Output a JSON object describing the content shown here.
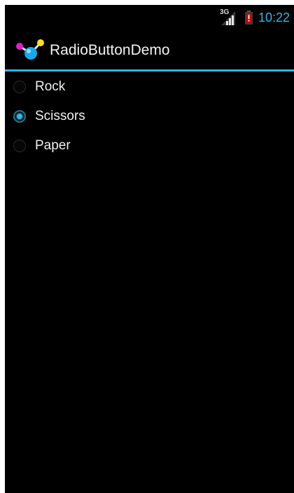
{
  "status_bar": {
    "network_type": "3G",
    "time": "10:22",
    "icons": [
      "signal-icon",
      "battery-alert-icon"
    ],
    "colors": {
      "clock": "#33b5e5",
      "battery_alert": "#cc0000"
    }
  },
  "action_bar": {
    "title": "RadioButtonDemo",
    "icon": "app-icon",
    "divider_color": "#33b5e5"
  },
  "radio_group": {
    "options": [
      {
        "label": "Rock",
        "checked": false
      },
      {
        "label": "Scissors",
        "checked": true
      },
      {
        "label": "Paper",
        "checked": false
      }
    ],
    "accent_color": "#33b5e5"
  }
}
